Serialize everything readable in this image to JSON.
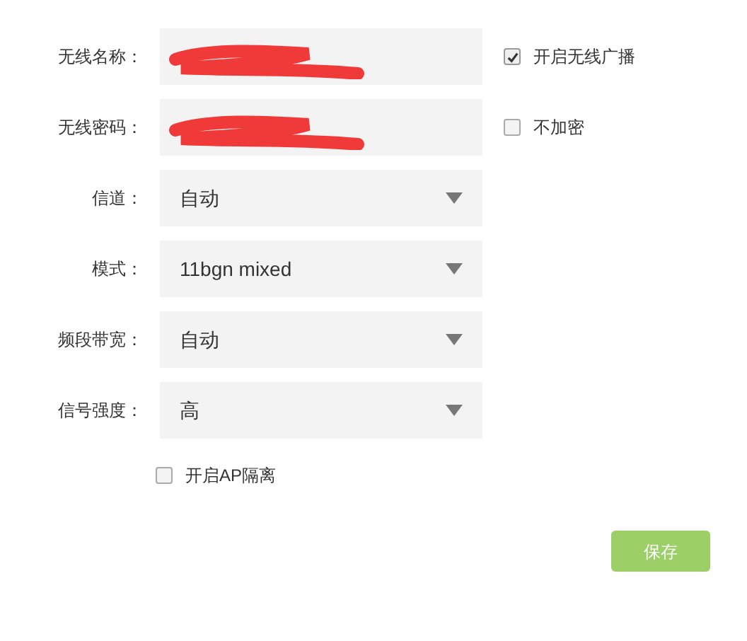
{
  "fields": [
    {
      "kind": "text",
      "label": "无线名称：",
      "redacted": true,
      "option": {
        "label": "开启无线广播",
        "checked": true
      }
    },
    {
      "kind": "text",
      "label": "无线密码：",
      "redacted": true,
      "option": {
        "label": "不加密",
        "checked": false
      }
    },
    {
      "kind": "select",
      "label": "信道：",
      "value": "自动"
    },
    {
      "kind": "select",
      "label": "模式：",
      "value": "11bgn mixed"
    },
    {
      "kind": "select",
      "label": "频段带宽：",
      "value": "自动"
    },
    {
      "kind": "select",
      "label": "信号强度：",
      "value": "高"
    }
  ],
  "ap_isolation": {
    "label": "开启AP隔离",
    "checked": false
  },
  "save_button": "保存"
}
